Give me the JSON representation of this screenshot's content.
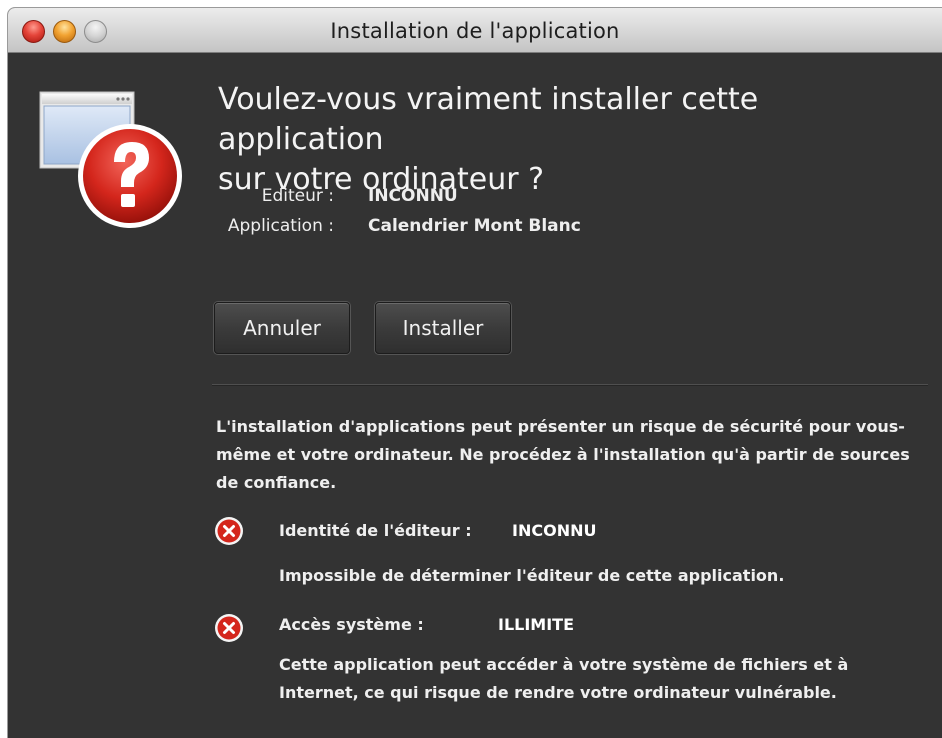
{
  "window": {
    "title": "Installation de l'application"
  },
  "dialog": {
    "heading_line1": "Voulez-vous vraiment installer cette application",
    "heading_line2": "sur votre ordinateur ?",
    "publisher_label": "Editeur :",
    "publisher_value": "INCONNU",
    "application_label": "Application :",
    "application_value": "Calendrier Mont Blanc"
  },
  "buttons": {
    "cancel_label": "Annuler",
    "install_label": "Installer"
  },
  "warning": {
    "text": "L'installation d'applications peut présenter un risque de sécurité pour vous-même et votre ordinateur. Ne procédez à l'installation qu'à partir de sources de confiance."
  },
  "risks": [
    {
      "label": "Identité de l'éditeur :",
      "value": "INCONNU",
      "description": "Impossible de déterminer l'éditeur de cette application."
    },
    {
      "label": "Accès système :",
      "value": "ILLIMITE",
      "description": "Cette application peut accéder à votre système de fichiers et à Internet, ce qui risque de rendre votre ordinateur vulnérable."
    }
  ],
  "icons": {
    "app_icon": "application-window-question-icon",
    "risk_icon": "red-x-circle-icon"
  },
  "colors": {
    "background": "#333333",
    "text": "#efefef",
    "alert_red": "#d4261c"
  }
}
